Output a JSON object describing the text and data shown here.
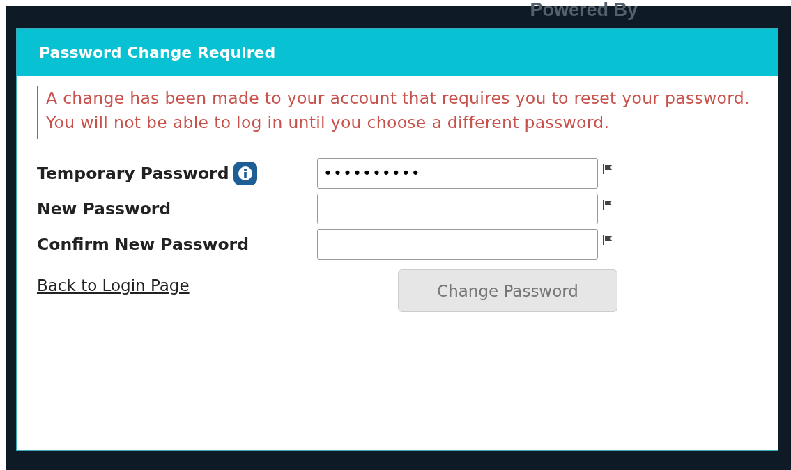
{
  "backdrop": {
    "powered_by": "Powered By"
  },
  "dialog": {
    "title": "Password Change Required",
    "alert": "A change has been made to your account that requires you to reset your password. You will not be able to log in until you choose a different password.",
    "fields": [
      {
        "label": "Temporary Password",
        "info": true,
        "value": "••••••••••"
      },
      {
        "label": "New Password",
        "info": false
      },
      {
        "label": "Confirm New Password",
        "info": false
      }
    ],
    "back_link": "Back to Login Page",
    "submit": {
      "label": "Change Password",
      "disabled": true
    }
  }
}
